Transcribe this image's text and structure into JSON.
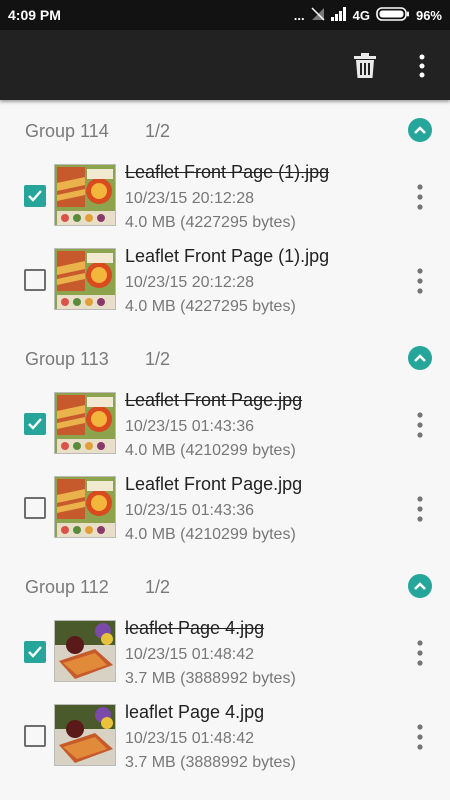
{
  "status_bar": {
    "time": "4:09 PM",
    "dots": "...",
    "network": "4G",
    "battery": "96%"
  },
  "toolbar": {
    "delete_icon": "trash-icon",
    "overflow_icon": "more-vert-icon"
  },
  "colors": {
    "accent": "#26a69a",
    "toolbar": "#222222",
    "status_bar": "#121212",
    "background": "#f7f7f7"
  },
  "groups": [
    {
      "name": "Group 114",
      "count": "1/2",
      "items": [
        {
          "name": "Leaflet Front Page (1).jpg",
          "date": "10/23/15 20:12:28",
          "size": "4.0 MB (4227295 bytes)",
          "checked": true
        },
        {
          "name": "Leaflet Front Page (1).jpg",
          "date": "10/23/15 20:12:28",
          "size": "4.0 MB (4227295 bytes)",
          "checked": false
        }
      ]
    },
    {
      "name": "Group 113",
      "count": "1/2",
      "items": [
        {
          "name": "Leaflet Front Page.jpg",
          "date": "10/23/15 01:43:36",
          "size": "4.0 MB (4210299 bytes)",
          "checked": true
        },
        {
          "name": "Leaflet Front Page.jpg",
          "date": "10/23/15 01:43:36",
          "size": "4.0 MB (4210299 bytes)",
          "checked": false
        }
      ]
    },
    {
      "name": "Group 112",
      "count": "1/2",
      "items": [
        {
          "name": "leaflet Page 4.jpg",
          "date": "10/23/15 01:48:42",
          "size": "3.7 MB (3888992 bytes)",
          "checked": true
        },
        {
          "name": "leaflet Page 4.jpg",
          "date": "10/23/15 01:48:42",
          "size": "3.7 MB (3888992 bytes)",
          "checked": false
        }
      ]
    }
  ]
}
